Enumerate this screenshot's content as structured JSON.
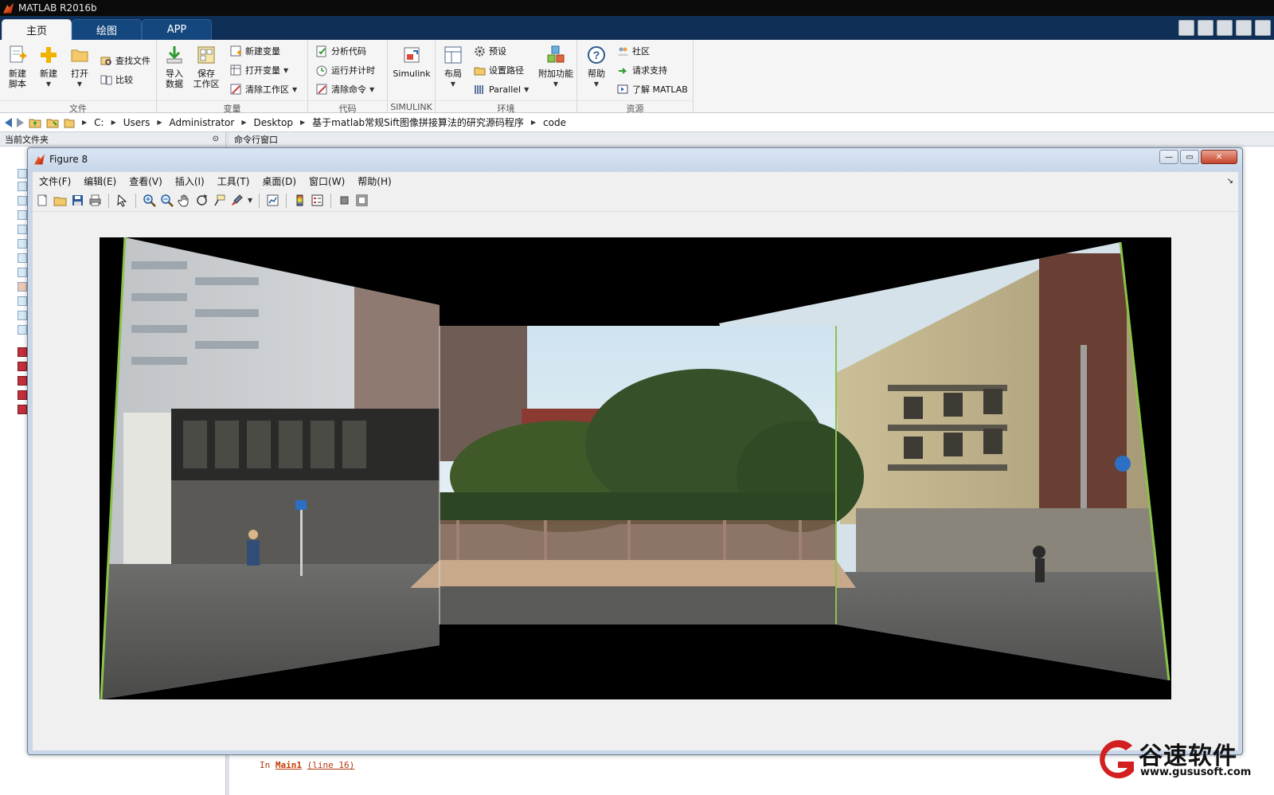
{
  "app": {
    "title": "MATLAB R2016b"
  },
  "tabs": [
    {
      "label": "主页",
      "active": true
    },
    {
      "label": "绘图",
      "active": false
    },
    {
      "label": "APP",
      "active": false
    }
  ],
  "ribbon": {
    "file": {
      "section_label": "文件",
      "new_script": "新建\n脚本",
      "new": "新建",
      "open": "打开",
      "find_files": "查找文件",
      "compare": "比较"
    },
    "variable": {
      "section_label": "变量",
      "import_data": "导入\n数据",
      "save_workspace": "保存\n工作区",
      "new_variable": "新建变量",
      "open_variable": "打开变量",
      "clear_workspace": "清除工作区"
    },
    "code": {
      "section_label": "代码",
      "analyze_code": "分析代码",
      "run_and_time": "运行并计时",
      "clear_commands": "清除命令"
    },
    "simulink": {
      "section_label": "SIMULINK",
      "simulink": "Simulink"
    },
    "environment": {
      "section_label": "环境",
      "layout": "布局",
      "preferences": "预设",
      "set_path": "设置路径",
      "parallel": "Parallel",
      "add_ons": "附加功能"
    },
    "resources": {
      "section_label": "资源",
      "help": "帮助",
      "community": "社区",
      "request_support": "请求支持",
      "learn_matlab": "了解 MATLAB"
    }
  },
  "address": {
    "crumbs": [
      "C:",
      "Users",
      "Administrator",
      "Desktop",
      "基于matlab常规Sift图像拼接算法的研究源码程序",
      "code"
    ]
  },
  "panels": {
    "current_folder": "当前文件夹",
    "command_window": "命令行窗口"
  },
  "command_window": {
    "in_text": "In",
    "function_link": "Main1",
    "line_text": "(line 16)"
  },
  "figure": {
    "title": "Figure 8",
    "menu": [
      "文件(F)",
      "编辑(E)",
      "查看(V)",
      "插入(I)",
      "工具(T)",
      "桌面(D)",
      "窗口(W)",
      "帮助(H)"
    ]
  },
  "colors": {
    "tabbar_bg": "#0f2f57",
    "tab_bg": "#14477e",
    "ribbon_bg": "#f5f5f5",
    "seam_green": "#8bc34a"
  },
  "watermark": {
    "brand": "谷速软件",
    "url": "www.gususoft.com"
  }
}
